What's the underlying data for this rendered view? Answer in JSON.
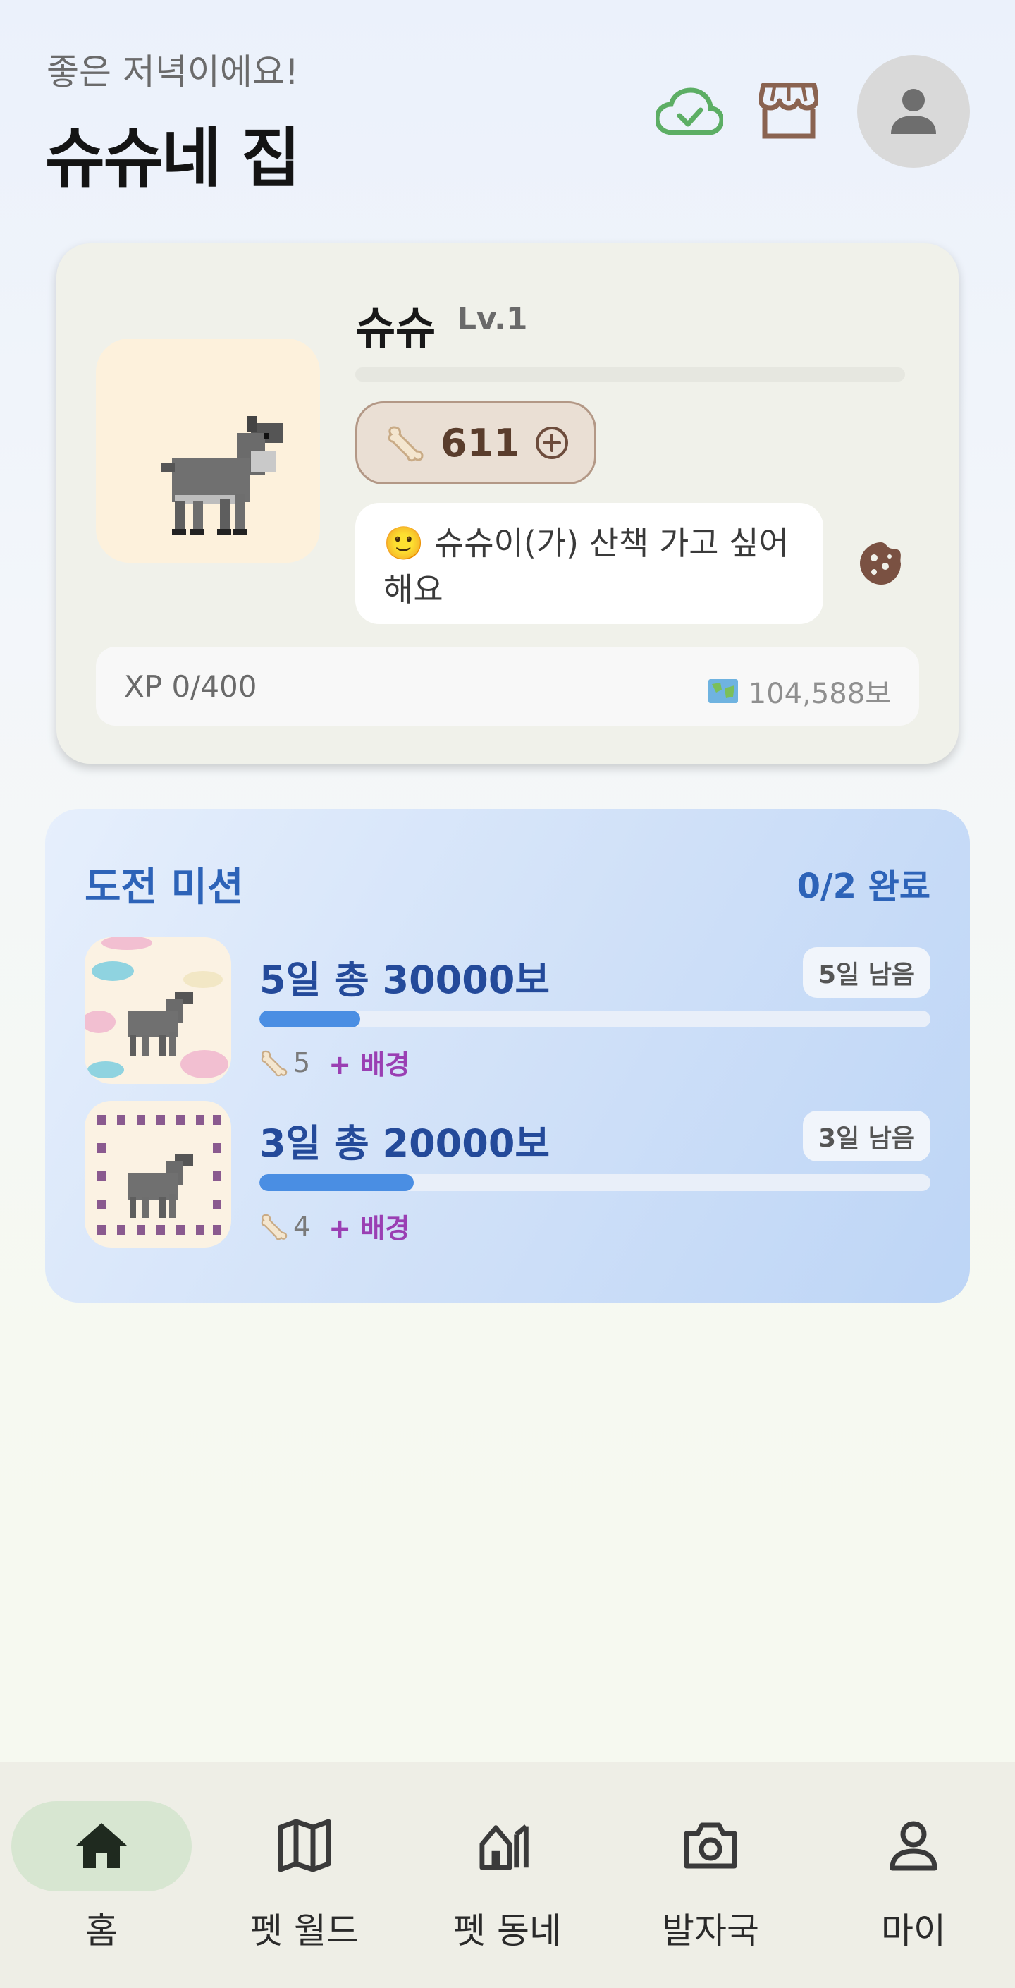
{
  "header": {
    "greeting": "좋은 저녁이에요!",
    "title": "슈슈네 집",
    "icons": [
      "cloud-check-icon",
      "store-icon",
      "person-icon"
    ]
  },
  "pet": {
    "name": "슈슈",
    "level": "Lv.1",
    "level_progress": 0,
    "bones": "611",
    "speech": "🙂 슈슈이(가) 산책 가고 싶어해요",
    "xp": "XP 0/400",
    "steps": "104,588보"
  },
  "missions": {
    "title": "도전 미션",
    "progress": "0/2 완료",
    "items": [
      {
        "name": "5일 총 30000보",
        "days_left": "5일 남음",
        "progress": 0.15,
        "reward_count": "5",
        "reward_extra": "+ 배경"
      },
      {
        "name": "3일 총 20000보",
        "days_left": "3일 남음",
        "progress": 0.23,
        "reward_count": "4",
        "reward_extra": "+ 배경"
      }
    ]
  },
  "nav": {
    "items": [
      {
        "label": "홈",
        "icon": "home-icon",
        "active": true
      },
      {
        "label": "펫 월드",
        "icon": "map-icon",
        "active": false
      },
      {
        "label": "펫 동네",
        "icon": "neighborhood-icon",
        "active": false
      },
      {
        "label": "발자국",
        "icon": "camera-icon",
        "active": false
      },
      {
        "label": "마이",
        "icon": "person-icon",
        "active": false
      }
    ]
  },
  "colors": {
    "accent_blue": "#2d63b8",
    "progress_fill": "#4a8ee3",
    "reward_purple": "#9a3fb3",
    "sync_green": "#5cae64",
    "brown": "#8a6350"
  }
}
